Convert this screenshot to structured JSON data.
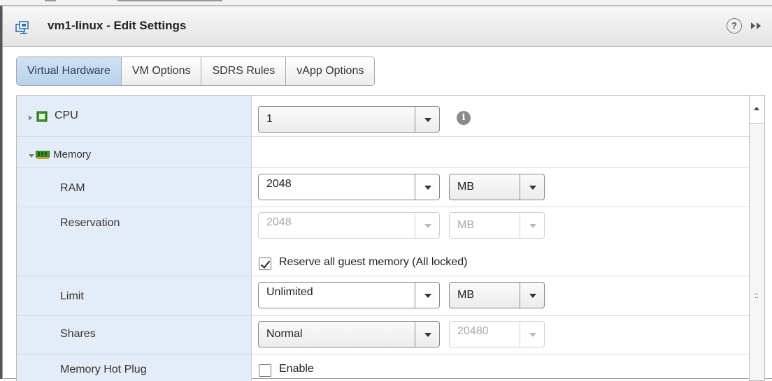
{
  "window": {
    "title": "vm1-linux - Edit Settings",
    "help_glyph": "?",
    "icons": [
      "vm-icon",
      "help-icon",
      "collapse-icon"
    ]
  },
  "tabs": [
    {
      "label": "Virtual Hardware",
      "active": true
    },
    {
      "label": "VM Options",
      "active": false
    },
    {
      "label": "SDRS Rules",
      "active": false
    },
    {
      "label": "vApp Options",
      "active": false
    }
  ],
  "hardware": {
    "cpu": {
      "label": "CPU",
      "value": "1",
      "info_glyph": "i"
    },
    "memory": {
      "label": "Memory",
      "ram": {
        "label": "RAM",
        "value": "2048",
        "unit": "MB"
      },
      "reservation": {
        "label": "Reservation",
        "value": "2048",
        "unit": "MB",
        "disabled": true
      },
      "reserve_all": {
        "label": "Reserve all guest memory (All locked)",
        "checked": true
      },
      "limit": {
        "label": "Limit",
        "value": "Unlimited",
        "unit": "MB"
      },
      "shares": {
        "label": "Shares",
        "value": "Normal",
        "amount": "20480",
        "amount_disabled": true
      },
      "hot_plug": {
        "label": "Memory Hot Plug",
        "checkbox_label": "Enable",
        "checked": false
      }
    }
  },
  "colors": {
    "accent_tab": "#b9d2ec",
    "label_column": "#e4edf7",
    "chip_green": "#3e9a2e"
  }
}
